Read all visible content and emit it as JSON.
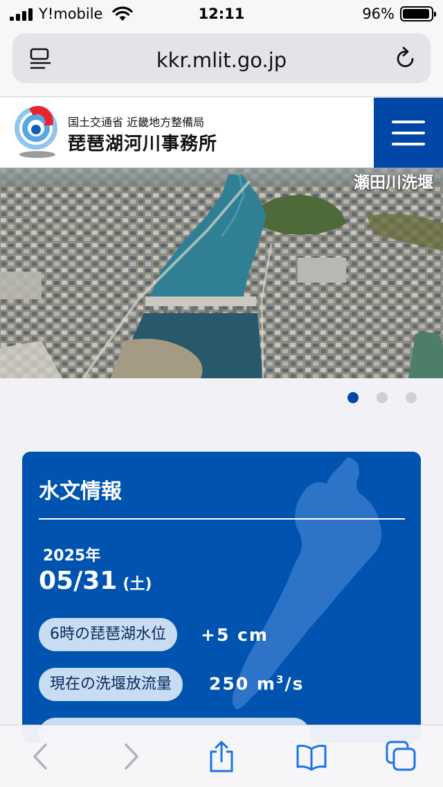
{
  "status_bar": {
    "carrier": "Y!mobile",
    "time": "12:11",
    "battery_percent": "96%",
    "battery_level": 0.96
  },
  "browser": {
    "url": "kkr.mlit.go.jp"
  },
  "site_header": {
    "org_line1": "国土交通省 近畿地方整備局",
    "org_line2": "琵琶湖河川事務所",
    "brand_color": "#0047a8"
  },
  "hero": {
    "caption": "瀬田川洗堰",
    "slide_count": 3,
    "active_slide": 1
  },
  "hydro": {
    "title": "水文情報",
    "year": "2025年",
    "date": "05/31",
    "weekday": "(土)",
    "lake_level_label": "6時の琵琶湖水位",
    "lake_level_value": "+5 cm",
    "discharge_label": "現在の洗堰放流量",
    "discharge_value": "250 m",
    "discharge_unit_exp": "3",
    "discharge_unit_tail": "/s",
    "card_color": "#0054b0"
  },
  "toolbar": {
    "icons": [
      "back-icon",
      "forward-icon",
      "share-icon",
      "bookmarks-icon",
      "tabs-icon"
    ]
  }
}
